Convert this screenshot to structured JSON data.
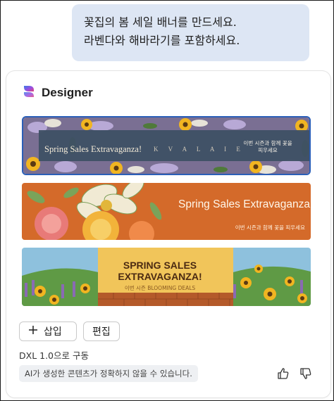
{
  "user_message": {
    "line1": "꽃집의 봄 세일 배너를 만드세요.",
    "line2": "라벤다와 해바라기를 포함하세요."
  },
  "designer": {
    "title": "Designer",
    "banners": [
      {
        "headline": "Spring Sales Extravaganza!",
        "brand_text": "K V A L A I E",
        "subtext_line1": "이번 시즌과 함께 꽃을",
        "subtext_line2": "피우세요"
      },
      {
        "headline": "Spring Sales Extravaganza!",
        "subtext": "이번 시즌과 함께 꽃을 피우세요"
      },
      {
        "headline_line1": "SPRING SALES",
        "headline_line2": "EXTRAVAGANZA!",
        "subtext": "이번 시즌 BLOOMING DEALS"
      }
    ],
    "insert_label": "삽입",
    "edit_label": "편집",
    "powered_by": "DXL 1.0으로 구동",
    "disclaimer": "AI가 생성한 콘텐츠가 정확하지 않을 수 있습니다."
  },
  "colors": {
    "bubble": "#dde6f4",
    "selection": "#2b5fb8",
    "banner1_bg": "#7a6f93",
    "banner2_bg": "#d46a2a",
    "banner3_bg": "#f1c55a"
  }
}
